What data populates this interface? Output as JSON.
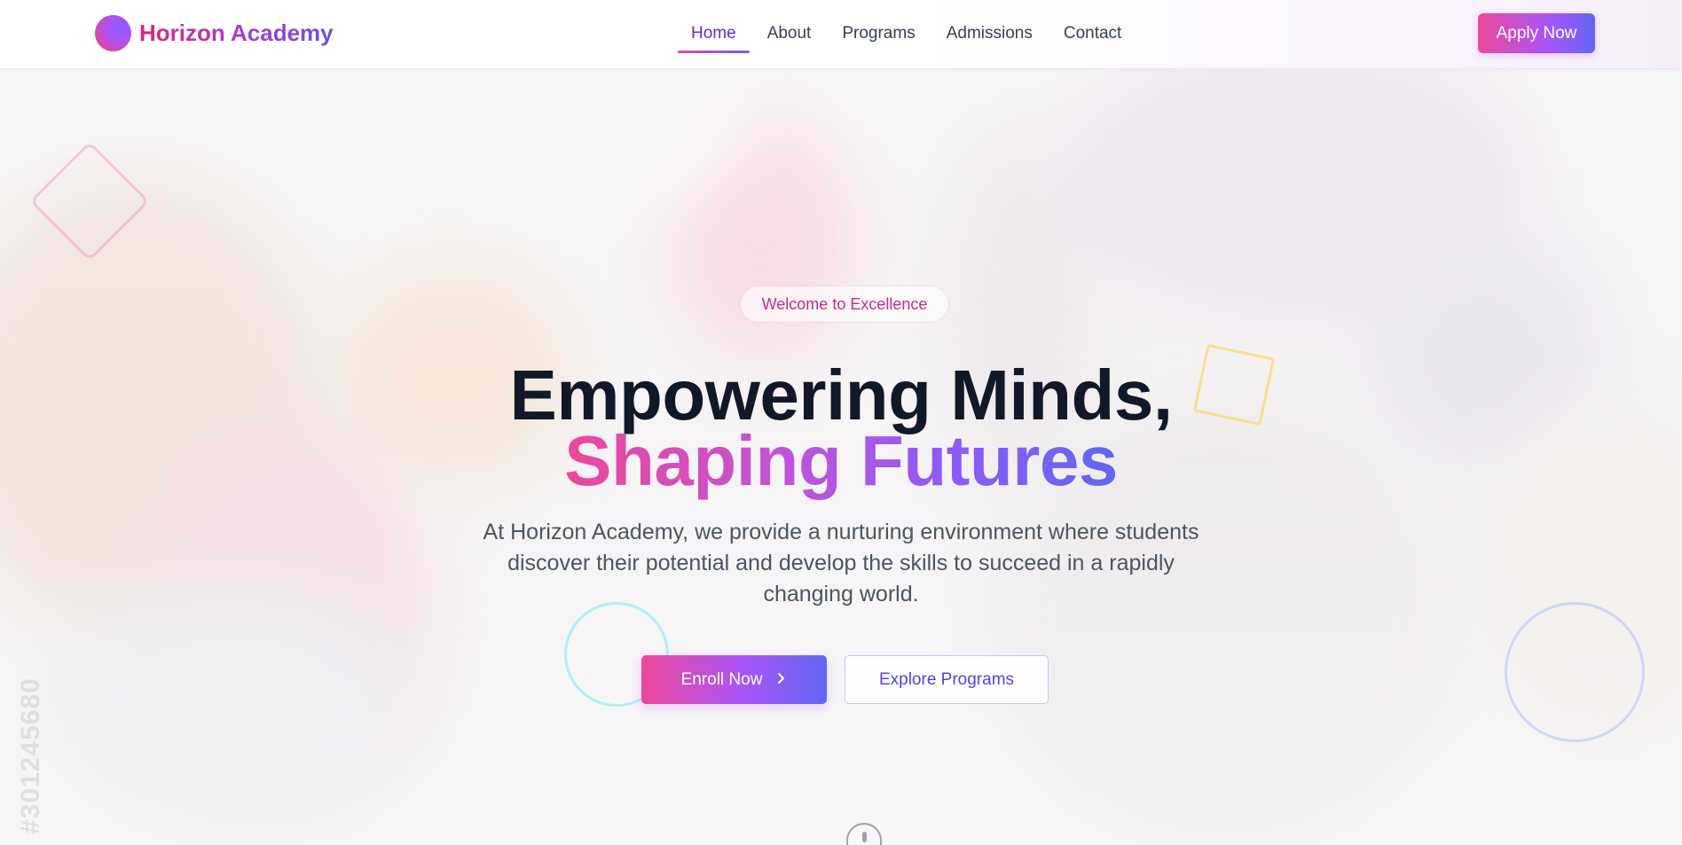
{
  "brand": {
    "name": "Horizon Academy"
  },
  "nav": {
    "items": [
      {
        "label": "Home",
        "active": true
      },
      {
        "label": "About",
        "active": false
      },
      {
        "label": "Programs",
        "active": false
      },
      {
        "label": "Admissions",
        "active": false
      },
      {
        "label": "Contact",
        "active": false
      }
    ]
  },
  "header": {
    "apply_label": "Apply Now"
  },
  "hero": {
    "badge": "Welcome to Excellence",
    "title_line1": "Empowering Minds,",
    "title_line2": "Shaping Futures",
    "subtitle": "At Horizon Academy, we provide a nurturing environment where students discover their potential and develop the skills to succeed in a rapidly changing world.",
    "primary_cta": "Enroll Now",
    "secondary_cta": "Explore Programs",
    "watermark": "#301245680"
  },
  "colors": {
    "accent_pink": "#ec4899",
    "accent_purple": "#a855f7",
    "accent_indigo": "#6366f1",
    "heading": "#111827"
  },
  "icons": {
    "logo": "gradient-circle-icon",
    "cta_arrow": "chevron-right-icon",
    "scroll": "mouse-scroll-icon"
  }
}
